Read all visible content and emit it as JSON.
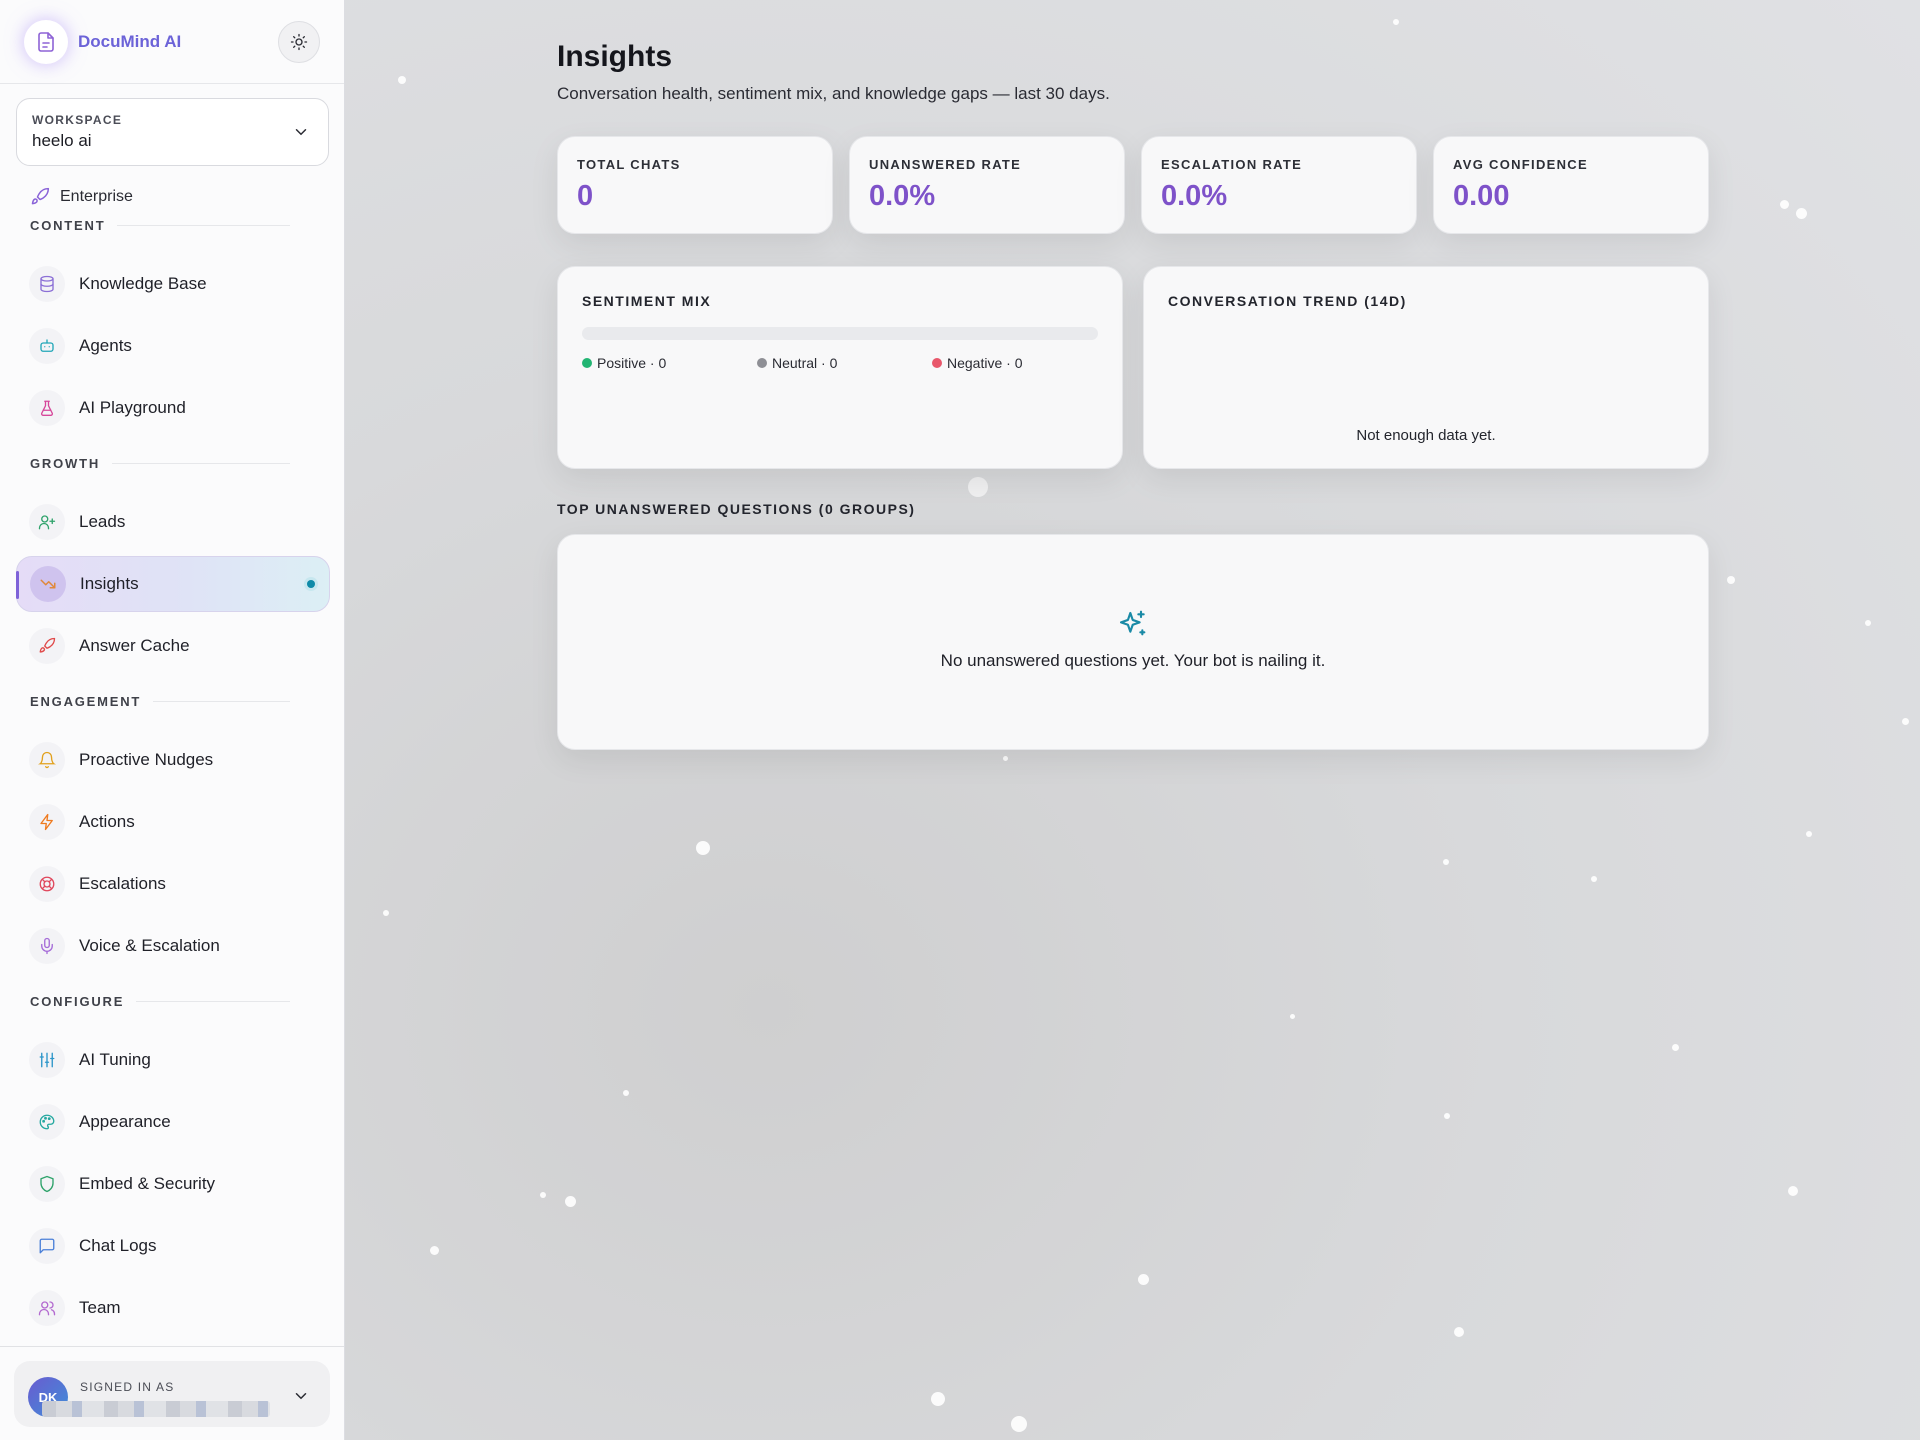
{
  "brand": {
    "name": "DocuMind AI",
    "logo_icon": "document-sparkle-icon",
    "theme_icon": "sun-icon"
  },
  "workspace": {
    "label": "WORKSPACE",
    "value": "heelo ai"
  },
  "plan": {
    "label": "Enterprise",
    "icon": "rocket-icon"
  },
  "sidebar": {
    "sections": [
      {
        "title": "CONTENT",
        "items": [
          {
            "label": "Knowledge Base",
            "icon": "database-icon",
            "color": "#8b6fd6"
          },
          {
            "label": "Agents",
            "icon": "robot-icon",
            "color": "#22a7b8"
          },
          {
            "label": "AI Playground",
            "icon": "flask-icon",
            "color": "#d6479a"
          }
        ]
      },
      {
        "title": "GROWTH",
        "items": [
          {
            "label": "Leads",
            "icon": "user-plus-icon",
            "color": "#2fa36b"
          },
          {
            "label": "Insights",
            "icon": "trending-icon",
            "color": "#e0883a",
            "active": true
          },
          {
            "label": "Answer Cache",
            "icon": "rocket-icon",
            "color": "#e04a4a"
          }
        ]
      },
      {
        "title": "ENGAGEMENT",
        "items": [
          {
            "label": "Proactive Nudges",
            "icon": "bell-icon",
            "color": "#e2a11d"
          },
          {
            "label": "Actions",
            "icon": "lightning-icon",
            "color": "#ef7a1f"
          },
          {
            "label": "Escalations",
            "icon": "lifebuoy-icon",
            "color": "#e0475c"
          },
          {
            "label": "Voice & Escalation",
            "icon": "microphone-icon",
            "color": "#a56bd8"
          }
        ]
      },
      {
        "title": "CONFIGURE",
        "items": [
          {
            "label": "AI Tuning",
            "icon": "sliders-icon",
            "color": "#2b95c9"
          },
          {
            "label": "Appearance",
            "icon": "palette-icon",
            "color": "#25a8a0"
          },
          {
            "label": "Embed & Security",
            "icon": "shield-icon",
            "color": "#2fa36b"
          },
          {
            "label": "Chat Logs",
            "icon": "chat-icon",
            "color": "#4a7fd8"
          },
          {
            "label": "Team",
            "icon": "users-icon",
            "color": "#b36ad0"
          }
        ]
      }
    ]
  },
  "user": {
    "label": "SIGNED IN AS",
    "initials": "DK"
  },
  "page": {
    "title": "Insights",
    "subtitle": "Conversation health, sentiment mix, and knowledge gaps — last 30 days."
  },
  "stats": [
    {
      "label": "TOTAL CHATS",
      "value": "0"
    },
    {
      "label": "UNANSWERED RATE",
      "value": "0.0%"
    },
    {
      "label": "ESCALATION RATE",
      "value": "0.0%"
    },
    {
      "label": "AVG CONFIDENCE",
      "value": "0.00"
    }
  ],
  "sentiment": {
    "title": "SENTIMENT MIX",
    "legend": [
      {
        "label": "Positive · 0",
        "color": "#22b573"
      },
      {
        "label": "Neutral · 0",
        "color": "#8e8f95"
      },
      {
        "label": "Negative · 0",
        "color": "#e8576b"
      }
    ]
  },
  "trend": {
    "title": "CONVERSATION TREND (14D)",
    "empty": "Not enough data yet."
  },
  "unanswered": {
    "title": "TOP UNANSWERED QUESTIONS (0 GROUPS)",
    "empty_icon": "sparkles-icon",
    "empty": "No unanswered questions yet. Your bot is nailing it."
  }
}
